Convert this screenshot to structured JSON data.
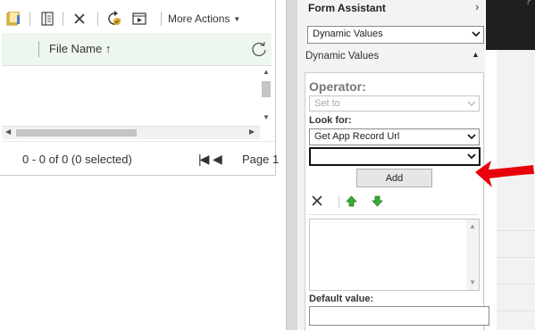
{
  "toolbar": {
    "icons": [
      "file-icon",
      "document-icon",
      "delete-x-icon",
      "run-icon",
      "play-media-icon"
    ],
    "more_actions_label": "More Actions"
  },
  "grid": {
    "column_header": "File Name ↑",
    "footer_count": "0 - 0 of 0 (0 selected)",
    "page_label": "Page 1"
  },
  "form_assistant": {
    "title": "Form Assistant",
    "top_select_value": "Dynamic Values",
    "section_label": "Dynamic Values",
    "operator_label": "Operator:",
    "operator_value": "Set to",
    "look_for_label": "Look for:",
    "look_for_value": "Get App Record Url",
    "empty_select_value": "",
    "add_label": "Add",
    "default_value_label": "Default value:",
    "default_value": ""
  },
  "colors": {
    "header_bg": "#eef7ee",
    "annotation_arrow": "#e8000b",
    "up_arrow": "#3aaa35",
    "down_arrow": "#3aaa35"
  }
}
